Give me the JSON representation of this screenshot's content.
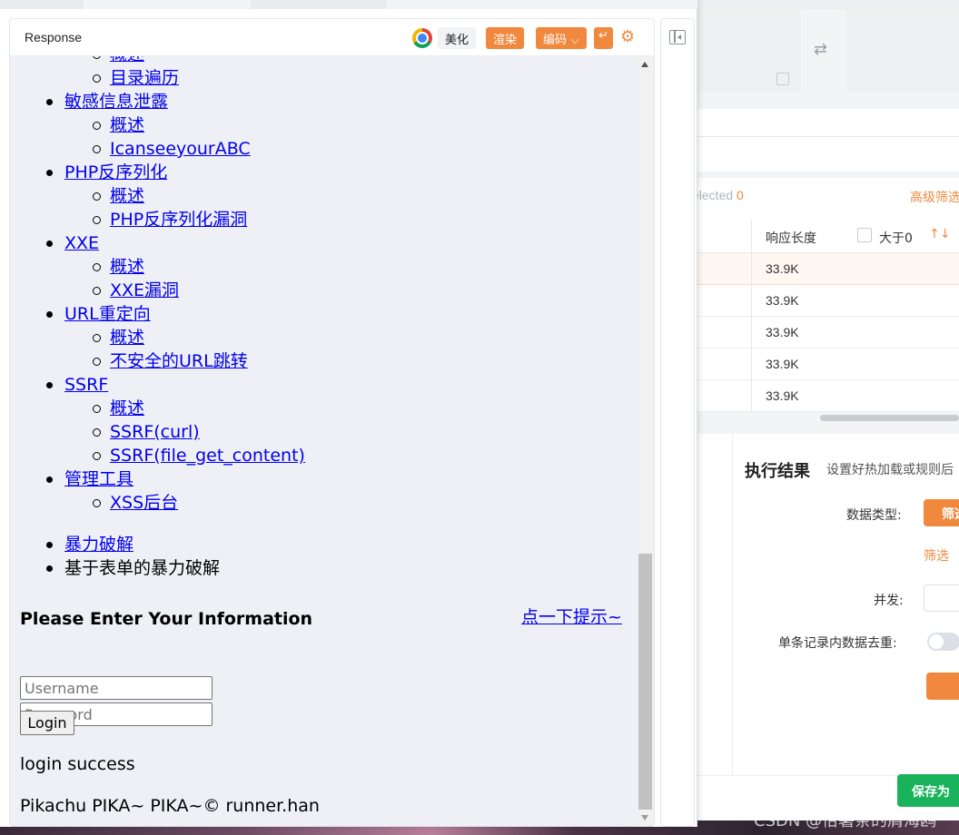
{
  "response_panel": {
    "title": "Response",
    "toolbar": {
      "beautify": "美化",
      "render": "渲染",
      "encoding": "编码",
      "encoding_chevron": "⌵",
      "wrap_symbol": "↵",
      "gear_symbol": "⚙"
    }
  },
  "page": {
    "menu": [
      {
        "label": null,
        "children": [
          "概述",
          "目录遍历"
        ]
      },
      {
        "label": "敏感信息泄露",
        "children": [
          "概述",
          "IcanseeyourABC"
        ]
      },
      {
        "label": "PHP反序列化",
        "children": [
          "概述",
          "PHP反序列化漏洞"
        ]
      },
      {
        "label": "XXE",
        "children": [
          "概述",
          "XXE漏洞"
        ]
      },
      {
        "label": "URL重定向",
        "children": [
          "概述",
          "不安全的URL跳转"
        ]
      },
      {
        "label": "SSRF",
        "children": [
          "概述",
          "SSRF(curl)",
          "SSRF(file_get_content)"
        ]
      },
      {
        "label": "管理工具",
        "children": [
          "XSS后台"
        ]
      }
    ],
    "crumbs": [
      "暴力破解",
      "基于表单的暴力破解"
    ],
    "form_title": "Please Enter Your Information",
    "tip_link": "点一下提示~",
    "username_placeholder": "Username",
    "password_placeholder": "Password",
    "login_button": "Login",
    "login_message": "login success",
    "footer": "Pikachu PIKA~ PIKA~© runner.han"
  },
  "background": {
    "swap_symbol": "⇄",
    "selected_label": "elected",
    "selected_count": "0",
    "advanced_filter": "高级筛选",
    "table": {
      "column": "响应长度",
      "filter_label": "大于0",
      "sort_symbol": "↑↓",
      "rows": [
        "33.9K",
        "33.9K",
        "33.9K",
        "33.9K",
        "33.9K"
      ]
    },
    "result": {
      "title": "执行结果",
      "subtitle": "设置好热加载或规则后",
      "data_type_label": "数据类型:",
      "filter_button": "筛选",
      "filter_link": "筛选",
      "concurrency_label": "并发:",
      "dedupe_label": "单条记录内数据去重:"
    },
    "save_button": "保存为",
    "watermark": "CSDN @恰薯条的屑海鸥"
  }
}
